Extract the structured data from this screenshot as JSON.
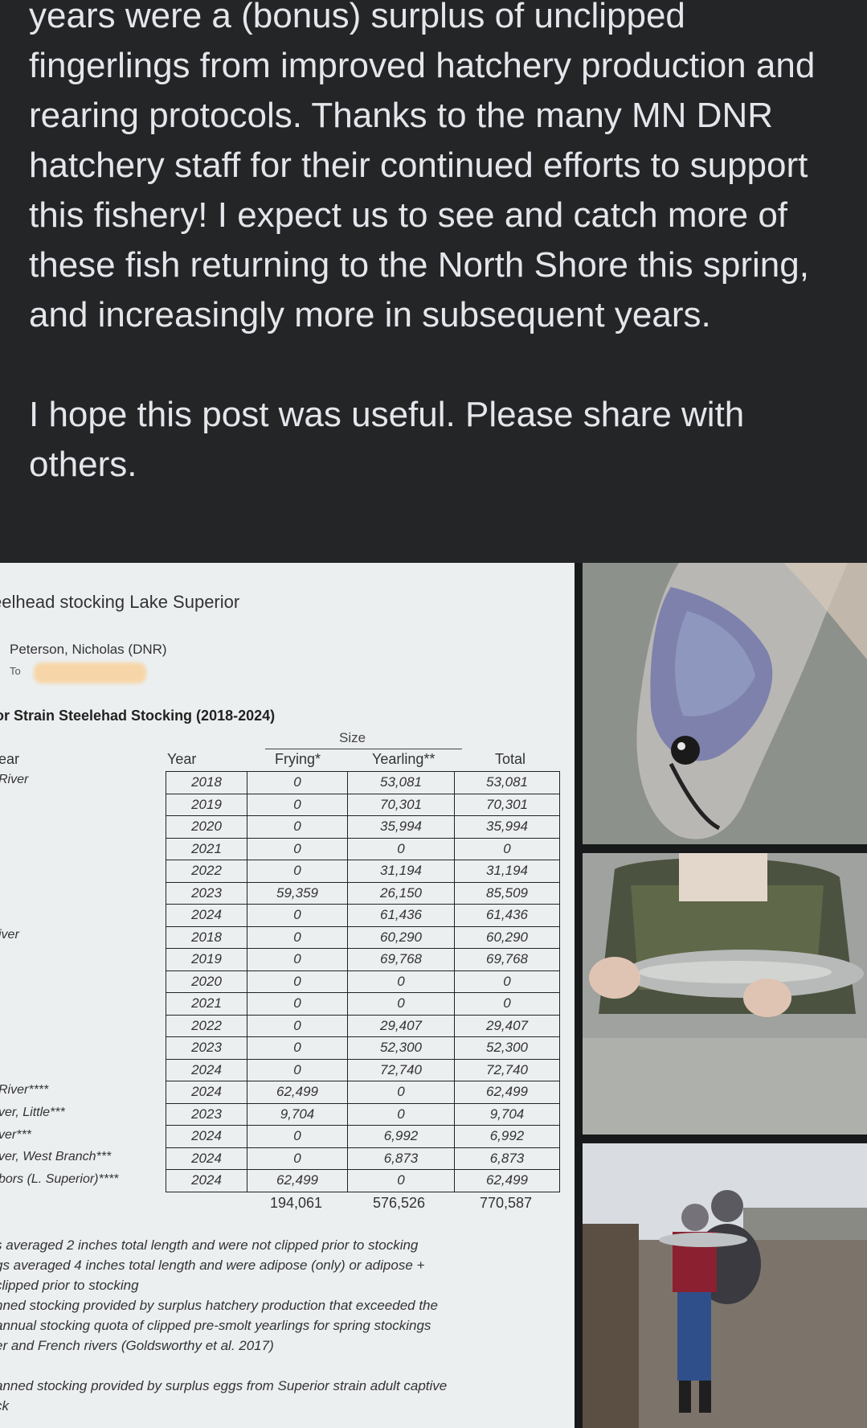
{
  "post": {
    "paragraph1": "years were a (bonus) surplus of unclipped fingerlings from improved hatchery production and rearing protocols. Thanks to the many MN DNR hatchery staff for their continued efforts to support this fishery! I expect us to see and catch more of these fish returning to the North Shore this spring, and increasingly more in subsequent years.",
    "paragraph2": "I hope this post was useful. Please share with others."
  },
  "document": {
    "subject": "eelhead stocking Lake Superior",
    "from": "Peterson, Nicholas (DNR)",
    "to_label": "To",
    "heading": "or Strain Steelehad Stocking (2018-2024)",
    "size_label": "Size",
    "headers": {
      "river": "ear",
      "year": "Year",
      "frying": "Frying*",
      "yearling": "Yearling**",
      "total": "Total"
    },
    "row_labels": [
      {
        "label": "River",
        "row": 0
      },
      {
        "label": "iver",
        "row": 7
      },
      {
        "label": "River****",
        "row": 14
      },
      {
        "label": "ver, Little***",
        "row": 15
      },
      {
        "label": "ver***",
        "row": 16
      },
      {
        "label": "ver, West Branch***",
        "row": 17
      },
      {
        "label": "bors (L. Superior)****",
        "row": 18
      }
    ],
    "rows": [
      [
        "2018",
        "0",
        "53,081",
        "53,081"
      ],
      [
        "2019",
        "0",
        "70,301",
        "70,301"
      ],
      [
        "2020",
        "0",
        "35,994",
        "35,994"
      ],
      [
        "2021",
        "0",
        "0",
        "0"
      ],
      [
        "2022",
        "0",
        "31,194",
        "31,194"
      ],
      [
        "2023",
        "59,359",
        "26,150",
        "85,509"
      ],
      [
        "2024",
        "0",
        "61,436",
        "61,436"
      ],
      [
        "2018",
        "0",
        "60,290",
        "60,290"
      ],
      [
        "2019",
        "0",
        "69,768",
        "69,768"
      ],
      [
        "2020",
        "0",
        "0",
        "0"
      ],
      [
        "2021",
        "0",
        "0",
        "0"
      ],
      [
        "2022",
        "0",
        "29,407",
        "29,407"
      ],
      [
        "2023",
        "0",
        "52,300",
        "52,300"
      ],
      [
        "2024",
        "0",
        "72,740",
        "72,740"
      ],
      [
        "2024",
        "62,499",
        "0",
        "62,499"
      ],
      [
        "2023",
        "9,704",
        "0",
        "9,704"
      ],
      [
        "2024",
        "0",
        "6,992",
        "6,992"
      ],
      [
        "2024",
        "0",
        "6,873",
        "6,873"
      ],
      [
        "2024",
        "62,499",
        "0",
        "62,499"
      ]
    ],
    "totals": {
      "frying": "194,061",
      "yearling": "576,526",
      "total": "770,587"
    },
    "notes": [
      "s averaged 2 inches total length and were not clipped prior to stocking",
      "gs averaged 4 inches total length and were adipose (only) or adipose +",
      " clipped prior to stocking",
      "nned stocking provided by surplus hatchery production that exceeded the",
      " annual stocking quota of clipped pre-smolt yearlings for spring stockings",
      "er and French rivers (Goldsworthy et al. 2017)",
      "",
      "anned stocking provided by surplus eggs from Superior strain adult captive",
      "ck"
    ]
  },
  "photos": [
    {
      "name": "steelhead-head-photo"
    },
    {
      "name": "angler-holding-steelhead-photo"
    },
    {
      "name": "child-holding-fish-photo"
    }
  ]
}
